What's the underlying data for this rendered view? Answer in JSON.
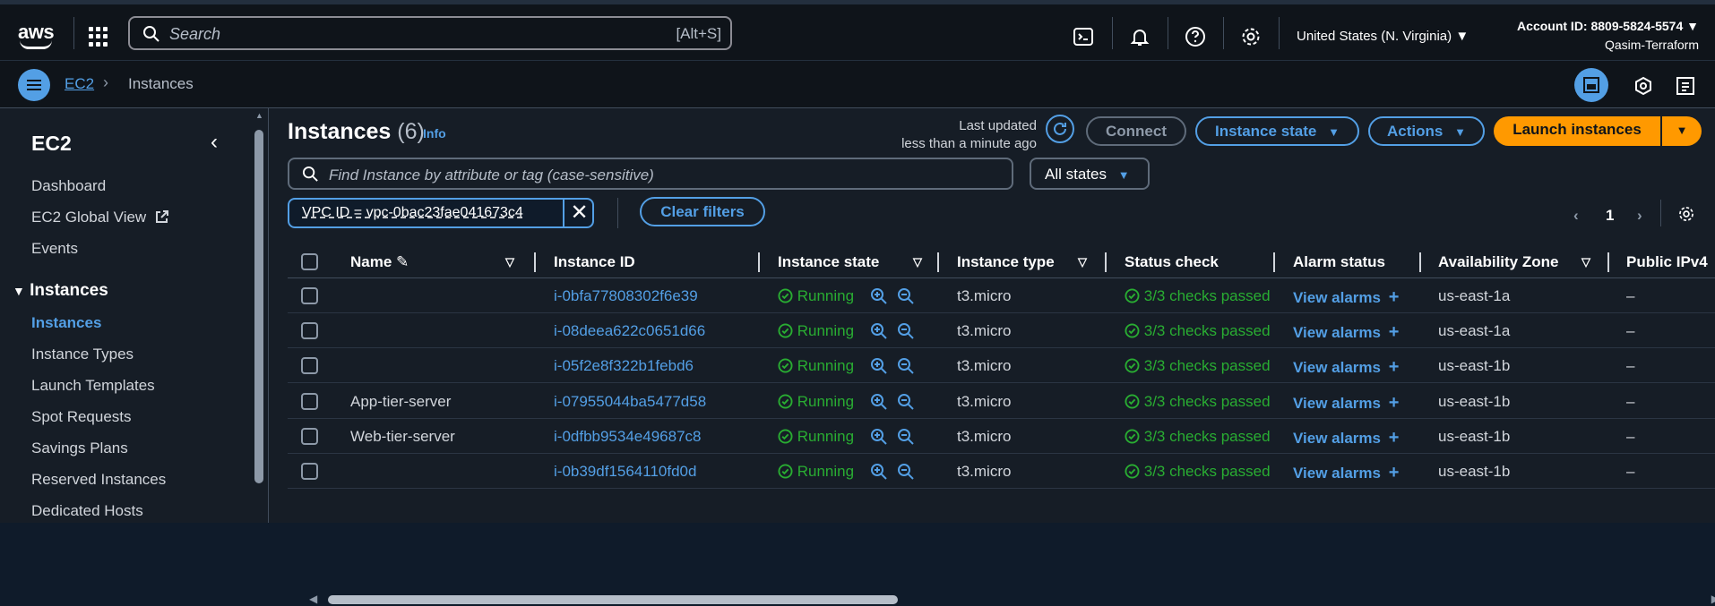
{
  "topbar": {
    "logo": "aws",
    "search_placeholder": "Search",
    "search_shortcut": "[Alt+S]",
    "region": "United States (N. Virginia)",
    "account_id": "Account ID: 8809-5824-5574",
    "account_user": "Qasim-Terraform"
  },
  "breadcrumb": {
    "parent": "EC2",
    "current": "Instances"
  },
  "sidebar": {
    "title": "EC2",
    "items_top": [
      "Dashboard",
      "EC2 Global View",
      "Events"
    ],
    "section": "Instances",
    "section_items": [
      "Instances",
      "Instance Types",
      "Launch Templates",
      "Spot Requests",
      "Savings Plans",
      "Reserved Instances",
      "Dedicated Hosts"
    ]
  },
  "header": {
    "title": "Instances",
    "count": "(6)",
    "info": "Info",
    "last_updated_1": "Last updated",
    "last_updated_2": "less than a minute ago",
    "connect": "Connect",
    "instance_state": "Instance state",
    "actions": "Actions",
    "launch": "Launch instances"
  },
  "filters": {
    "find_placeholder": "Find Instance by attribute or tag (case-sensitive)",
    "states": "All states",
    "chip": "VPC ID = vpc-0bac23fae041673c4",
    "clear": "Clear filters",
    "page": "1"
  },
  "columns": [
    "Name",
    "Instance ID",
    "Instance state",
    "Instance type",
    "Status check",
    "Alarm status",
    "Availability Zone",
    "Public IPv4"
  ],
  "rows": [
    {
      "name": "",
      "id": "i-0bfa77808302f6e39",
      "state": "Running",
      "type": "t3.micro",
      "status": "3/3 checks passed",
      "alarm": "View alarms",
      "az": "us-east-1a",
      "ip": "–"
    },
    {
      "name": "",
      "id": "i-08deea622c0651d66",
      "state": "Running",
      "type": "t3.micro",
      "status": "3/3 checks passed",
      "alarm": "View alarms",
      "az": "us-east-1a",
      "ip": "–"
    },
    {
      "name": "",
      "id": "i-05f2e8f322b1febd6",
      "state": "Running",
      "type": "t3.micro",
      "status": "3/3 checks passed",
      "alarm": "View alarms",
      "az": "us-east-1b",
      "ip": "–"
    },
    {
      "name": "App-tier-server",
      "id": "i-07955044ba5477d58",
      "state": "Running",
      "type": "t3.micro",
      "status": "3/3 checks passed",
      "alarm": "View alarms",
      "az": "us-east-1b",
      "ip": "–"
    },
    {
      "name": "Web-tier-server",
      "id": "i-0dfbb9534e49687c8",
      "state": "Running",
      "type": "t3.micro",
      "status": "3/3 checks passed",
      "alarm": "View alarms",
      "az": "us-east-1b",
      "ip": "–"
    },
    {
      "name": "",
      "id": "i-0b39df1564110fd0d",
      "state": "Running",
      "type": "t3.micro",
      "status": "3/3 checks passed",
      "alarm": "View alarms",
      "az": "us-east-1b",
      "ip": "–"
    }
  ],
  "colors": {
    "accent": "#539fe5",
    "orange": "#ff9900",
    "green": "#29ad32"
  }
}
